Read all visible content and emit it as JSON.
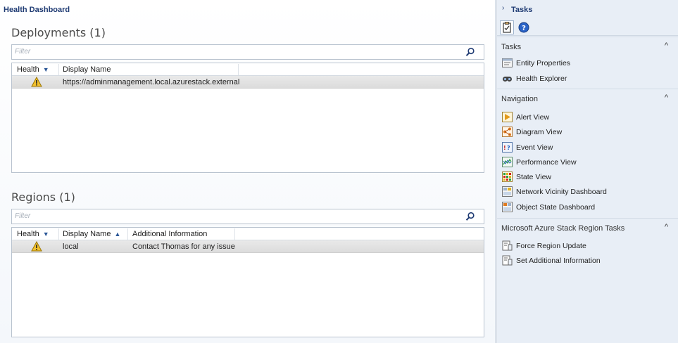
{
  "breadcrumb": "Health Dashboard",
  "deployments": {
    "title": "Deployments (1)",
    "filter_placeholder": "Filter",
    "columns": {
      "health": "Health",
      "display_name": "Display Name"
    },
    "rows": [
      {
        "health": "warning",
        "display_name": "https://adminmanagement.local.azurestack.external"
      }
    ]
  },
  "regions": {
    "title": "Regions (1)",
    "filter_placeholder": "Filter",
    "columns": {
      "health": "Health",
      "display_name": "Display Name",
      "additional_info": "Additional Information"
    },
    "rows": [
      {
        "health": "warning",
        "display_name": "local",
        "additional_info": "Contact Thomas for any issue"
      }
    ]
  },
  "tasks_pane": {
    "title": "Tasks",
    "groups": [
      {
        "title": "Tasks",
        "items": [
          {
            "label": "Entity Properties",
            "icon": "properties-icon"
          },
          {
            "label": "Health Explorer",
            "icon": "health-explorer-icon"
          }
        ]
      },
      {
        "title": "Navigation",
        "items": [
          {
            "label": "Alert View",
            "icon": "alert-view-icon"
          },
          {
            "label": "Diagram View",
            "icon": "diagram-view-icon"
          },
          {
            "label": "Event View",
            "icon": "event-view-icon"
          },
          {
            "label": "Performance View",
            "icon": "performance-view-icon"
          },
          {
            "label": "State View",
            "icon": "state-view-icon"
          },
          {
            "label": "Network Vicinity Dashboard",
            "icon": "network-vicinity-icon"
          },
          {
            "label": "Object State Dashboard",
            "icon": "object-state-icon"
          }
        ]
      },
      {
        "title": "Microsoft Azure Stack Region Tasks",
        "items": [
          {
            "label": "Force Region Update",
            "icon": "task-icon"
          },
          {
            "label": "Set Additional Information",
            "icon": "task-icon"
          }
        ]
      }
    ]
  },
  "colors": {
    "accent": "#1f3b73",
    "pane_bg": "#e8eef6",
    "warning": "#f2c12e"
  }
}
